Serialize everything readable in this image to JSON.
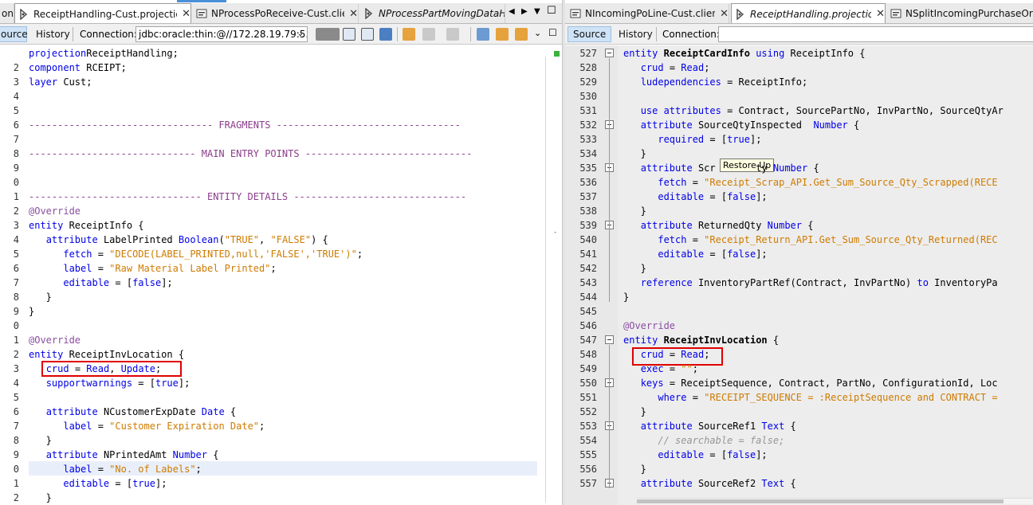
{
  "left": {
    "tabs": [
      {
        "label": "on",
        "active": false
      },
      {
        "label": "ReceiptHandling-Cust.projection",
        "active": true
      },
      {
        "label": "NProcessPoReceive-Cust.client",
        "active": false
      },
      {
        "label": "NProcessPartMovingDataH...",
        "active": false
      }
    ],
    "toolbar": {
      "source_label": "ource",
      "history_label": "History",
      "connection_label": "Connection:",
      "connection_value": "jdbc:oracle:thin:@//172.28.19.79:5..."
    },
    "line_numbers": [
      "",
      "2",
      "3",
      "4",
      "5",
      "6",
      "7",
      "8",
      "9",
      "0",
      "1",
      "2",
      "3",
      "4",
      "5",
      "6",
      "7",
      "8",
      "9",
      "0",
      "1",
      "2",
      "3",
      "4",
      "5",
      "6",
      "7",
      "8",
      "9",
      "0",
      "1",
      "2",
      "3"
    ],
    "lines": [
      [
        [
          "kw",
          "projection"
        ],
        [
          "",
          "ReceiptHandling;"
        ]
      ],
      [
        [
          "kw",
          "component"
        ],
        [
          "",
          " RCEIPT;"
        ]
      ],
      [
        [
          "kw",
          "layer"
        ],
        [
          "",
          " Cust;"
        ]
      ],
      [],
      [],
      [
        [
          "fragm",
          "-------------------------------- FRAGMENTS --------------------------------"
        ]
      ],
      [],
      [
        [
          "fragm",
          "----------------------------- MAIN ENTRY POINTS -----------------------------"
        ]
      ],
      [],
      [],
      [
        [
          "fragm",
          "------------------------------ ENTITY DETAILS ------------------------------"
        ]
      ],
      [
        [
          "ann",
          "@Override"
        ]
      ],
      [
        [
          "kw",
          "entity"
        ],
        [
          "",
          " ReceiptInfo {"
        ]
      ],
      [
        [
          "",
          "   "
        ],
        [
          "kw",
          "attribute"
        ],
        [
          "",
          " LabelPrinted "
        ],
        [
          "kw",
          "Boolean"
        ],
        [
          "",
          "("
        ],
        [
          "str",
          "\"TRUE\""
        ],
        [
          "",
          ", "
        ],
        [
          "str",
          "\"FALSE\""
        ],
        [
          "",
          ") {"
        ]
      ],
      [
        [
          "",
          "      "
        ],
        [
          "kw",
          "fetch"
        ],
        [
          "",
          " = "
        ],
        [
          "str",
          "\"DECODE(LABEL_PRINTED,null,'FALSE','TRUE')\""
        ],
        [
          "",
          ";"
        ]
      ],
      [
        [
          "",
          "      "
        ],
        [
          "kw",
          "label"
        ],
        [
          "",
          " = "
        ],
        [
          "str",
          "\"Raw Material Label Printed\""
        ],
        [
          "",
          ";"
        ]
      ],
      [
        [
          "",
          "      "
        ],
        [
          "kw",
          "editable"
        ],
        [
          "",
          " = ["
        ],
        [
          "kw",
          "false"
        ],
        [
          "",
          "];"
        ]
      ],
      [
        [
          "",
          "   }"
        ]
      ],
      [
        [
          "",
          "}"
        ]
      ],
      [],
      [
        [
          "ann",
          "@Override"
        ]
      ],
      [
        [
          "kw",
          "entity"
        ],
        [
          "",
          " ReceiptInvLocation {"
        ]
      ],
      [
        [
          "",
          "   "
        ],
        [
          "kw",
          "crud"
        ],
        [
          "",
          " = "
        ],
        [
          "kw",
          "Read"
        ],
        [
          "",
          ", "
        ],
        [
          "kw",
          "Update"
        ],
        [
          "",
          ";"
        ]
      ],
      [
        [
          "",
          "   "
        ],
        [
          "kw",
          "supportwarnings"
        ],
        [
          "",
          " = ["
        ],
        [
          "kw",
          "true"
        ],
        [
          "",
          "];"
        ]
      ],
      [],
      [
        [
          "",
          "   "
        ],
        [
          "kw",
          "attribute"
        ],
        [
          "",
          " NCustomerExpDate "
        ],
        [
          "kw",
          "Date"
        ],
        [
          "",
          " {"
        ]
      ],
      [
        [
          "",
          "      "
        ],
        [
          "kw",
          "label"
        ],
        [
          "",
          " = "
        ],
        [
          "str",
          "\"Customer Expiration Date\""
        ],
        [
          "",
          ";"
        ]
      ],
      [
        [
          "",
          "   }"
        ]
      ],
      [
        [
          "",
          "   "
        ],
        [
          "kw",
          "attribute"
        ],
        [
          "",
          " NPrintedAmt "
        ],
        [
          "kw",
          "Number"
        ],
        [
          "",
          " {"
        ]
      ],
      [
        [
          "",
          "      "
        ],
        [
          "kw",
          "label"
        ],
        [
          "",
          " = "
        ],
        [
          "str",
          "\"No. of Labels\""
        ],
        [
          "",
          ";"
        ]
      ],
      [
        [
          "",
          "      "
        ],
        [
          "kw",
          "editable"
        ],
        [
          "",
          " = ["
        ],
        [
          "kw",
          "true"
        ],
        [
          "",
          "];"
        ]
      ],
      [
        [
          "",
          "   }"
        ]
      ]
    ]
  },
  "right": {
    "tabs": [
      {
        "label": "NIncomingPoLine-Cust.client",
        "active": false
      },
      {
        "label": "ReceiptHandling.projection",
        "active": true
      },
      {
        "label": "NSplitIncomingPurchaseOrderL",
        "active": false
      }
    ],
    "toolbar": {
      "source_label": "Source",
      "history_label": "History",
      "connection_label": "Connection:"
    },
    "line_numbers": [
      "527",
      "528",
      "529",
      "530",
      "531",
      "532",
      "533",
      "534",
      "535",
      "536",
      "537",
      "538",
      "539",
      "540",
      "541",
      "542",
      "543",
      "544",
      "545",
      "546",
      "547",
      "548",
      "549",
      "550",
      "551",
      "552",
      "553",
      "554",
      "555",
      "556",
      "557"
    ],
    "lines": [
      [
        [
          "kw",
          "entity"
        ],
        [
          "",
          " "
        ],
        [
          "bold",
          "ReceiptCardInfo"
        ],
        [
          "",
          " "
        ],
        [
          "kw",
          "using"
        ],
        [
          "",
          " ReceiptInfo {"
        ]
      ],
      [
        [
          "",
          "   "
        ],
        [
          "kw",
          "crud"
        ],
        [
          "",
          " = "
        ],
        [
          "kw",
          "Read"
        ],
        [
          "",
          ";"
        ]
      ],
      [
        [
          "",
          "   "
        ],
        [
          "kw",
          "ludependencies"
        ],
        [
          "",
          " = ReceiptInfo;"
        ]
      ],
      [],
      [
        [
          "",
          "   "
        ],
        [
          "kw",
          "use attributes"
        ],
        [
          "",
          " = Contract, SourcePartNo, InvPartNo, SourceQtyAr"
        ]
      ],
      [
        [
          "",
          "   "
        ],
        [
          "kw",
          "attribute"
        ],
        [
          "",
          " SourceQtyInspected  "
        ],
        [
          "kw",
          "Number"
        ],
        [
          "",
          " {"
        ]
      ],
      [
        [
          "",
          "      "
        ],
        [
          "kw",
          "required"
        ],
        [
          "",
          " = ["
        ],
        [
          "kw",
          "true"
        ],
        [
          "",
          "];"
        ]
      ],
      [
        [
          "",
          "   }"
        ]
      ],
      [
        [
          "",
          "   "
        ],
        [
          "kw",
          "attribute"
        ],
        [
          "",
          " Scr       ty "
        ],
        [
          "kw",
          "Number"
        ],
        [
          "",
          " {"
        ]
      ],
      [
        [
          "",
          "      "
        ],
        [
          "kw",
          "fetch"
        ],
        [
          "",
          " = "
        ],
        [
          "str",
          "\"Receipt_Scrap_API.Get_Sum_Source_Qty_Scrapped(RECE"
        ]
      ],
      [
        [
          "",
          "      "
        ],
        [
          "kw",
          "editable"
        ],
        [
          "",
          " = ["
        ],
        [
          "kw",
          "false"
        ],
        [
          "",
          "];"
        ]
      ],
      [
        [
          "",
          "   }"
        ]
      ],
      [
        [
          "",
          "   "
        ],
        [
          "kw",
          "attribute"
        ],
        [
          "",
          " ReturnedQty "
        ],
        [
          "kw",
          "Number"
        ],
        [
          "",
          " {"
        ]
      ],
      [
        [
          "",
          "      "
        ],
        [
          "kw",
          "fetch"
        ],
        [
          "",
          " = "
        ],
        [
          "str",
          "\"Receipt_Return_API.Get_Sum_Source_Qty_Returned(REC"
        ]
      ],
      [
        [
          "",
          "      "
        ],
        [
          "kw",
          "editable"
        ],
        [
          "",
          " = ["
        ],
        [
          "kw",
          "false"
        ],
        [
          "",
          "];"
        ]
      ],
      [
        [
          "",
          "   }"
        ]
      ],
      [
        [
          "",
          "   "
        ],
        [
          "kw",
          "reference"
        ],
        [
          "",
          " InventoryPartRef(Contract, InvPartNo) "
        ],
        [
          "kw",
          "to"
        ],
        [
          "",
          " InventoryPa"
        ]
      ],
      [
        [
          "",
          "}"
        ]
      ],
      [],
      [
        [
          "ann",
          "@Override"
        ]
      ],
      [
        [
          "kw",
          "entity"
        ],
        [
          "",
          " "
        ],
        [
          "bold",
          "ReceiptInvLocation"
        ],
        [
          "",
          " {"
        ]
      ],
      [
        [
          "",
          "   "
        ],
        [
          "kw",
          "crud"
        ],
        [
          "",
          " = "
        ],
        [
          "kw",
          "Read"
        ],
        [
          "",
          ";"
        ]
      ],
      [
        [
          "",
          "   "
        ],
        [
          "kw",
          "exec"
        ],
        [
          "",
          " = "
        ],
        [
          "str",
          "\"\""
        ],
        [
          "",
          ";"
        ]
      ],
      [
        [
          "",
          "   "
        ],
        [
          "kw",
          "keys"
        ],
        [
          "",
          " = ReceiptSequence, Contract, PartNo, ConfigurationId, Loc"
        ]
      ],
      [
        [
          "",
          "      "
        ],
        [
          "kw",
          "where"
        ],
        [
          "",
          " = "
        ],
        [
          "str",
          "\"RECEIPT_SEQUENCE = :ReceiptSequence and CONTRACT = "
        ]
      ],
      [
        [
          "",
          "   }"
        ]
      ],
      [
        [
          "",
          "   "
        ],
        [
          "kw",
          "attribute"
        ],
        [
          "",
          " SourceRef1 "
        ],
        [
          "kw",
          "Text"
        ],
        [
          "",
          " {"
        ]
      ],
      [
        [
          "",
          "      "
        ],
        [
          "cmt",
          "// searchable = false;"
        ]
      ],
      [
        [
          "",
          "      "
        ],
        [
          "kw",
          "editable"
        ],
        [
          "",
          " = ["
        ],
        [
          "kw",
          "false"
        ],
        [
          "",
          "];"
        ]
      ],
      [
        [
          "",
          "   }"
        ]
      ],
      [
        [
          "",
          "   "
        ],
        [
          "kw",
          "attribute"
        ],
        [
          "",
          " SourceRef2 "
        ],
        [
          "kw",
          "Text"
        ],
        [
          "",
          " {"
        ]
      ]
    ],
    "tooltip": "Restore Up"
  },
  "colors": {
    "keyword": "#0000e6",
    "string": "#ce7b00",
    "annotation": "#8a4ea0",
    "highlight_box": "#e00000",
    "gutter_bg": "#e8e8e8"
  }
}
